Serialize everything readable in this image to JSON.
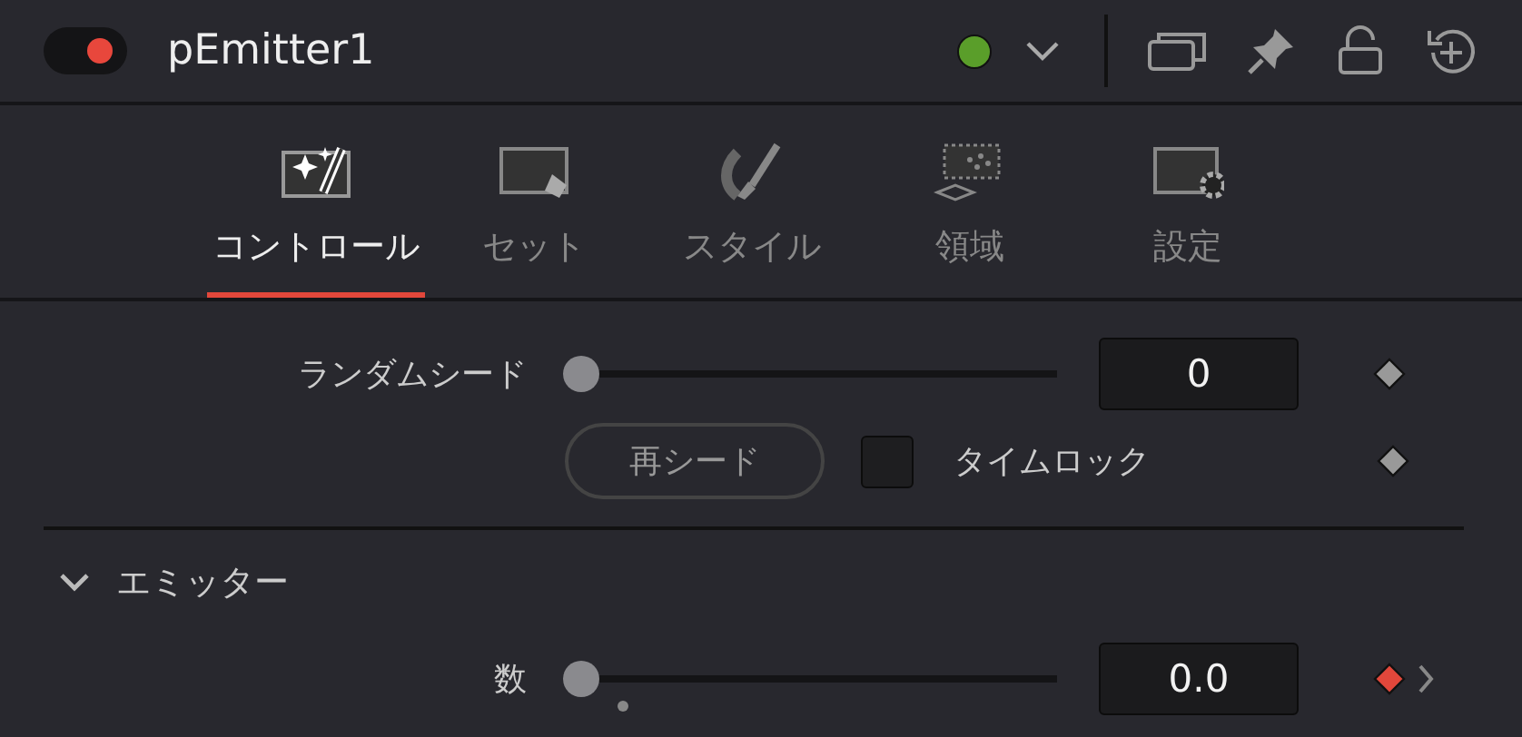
{
  "node": {
    "enabled": true,
    "name": "pEmitter1",
    "color": "#5a9e2a"
  },
  "tabs": [
    {
      "label": "コントロール",
      "selected": true
    },
    {
      "label": "セット",
      "selected": false
    },
    {
      "label": "スタイル",
      "selected": false
    },
    {
      "label": "領域",
      "selected": false
    },
    {
      "label": "設定",
      "selected": false
    }
  ],
  "controls": [
    {
      "kind": "slider",
      "label": "ランダムシード",
      "level": 0,
      "value": "0",
      "keyframed": false
    },
    {
      "kind": "button_check",
      "button": "再シード",
      "checkbox_label": "タイムロック",
      "checked": false,
      "keyframed": false
    }
  ],
  "sections": [
    {
      "title": "エミッター",
      "expanded": true,
      "controls": [
        {
          "kind": "slider",
          "label": "数",
          "level": 0,
          "value": "0.0",
          "keyframed": true
        }
      ]
    }
  ]
}
